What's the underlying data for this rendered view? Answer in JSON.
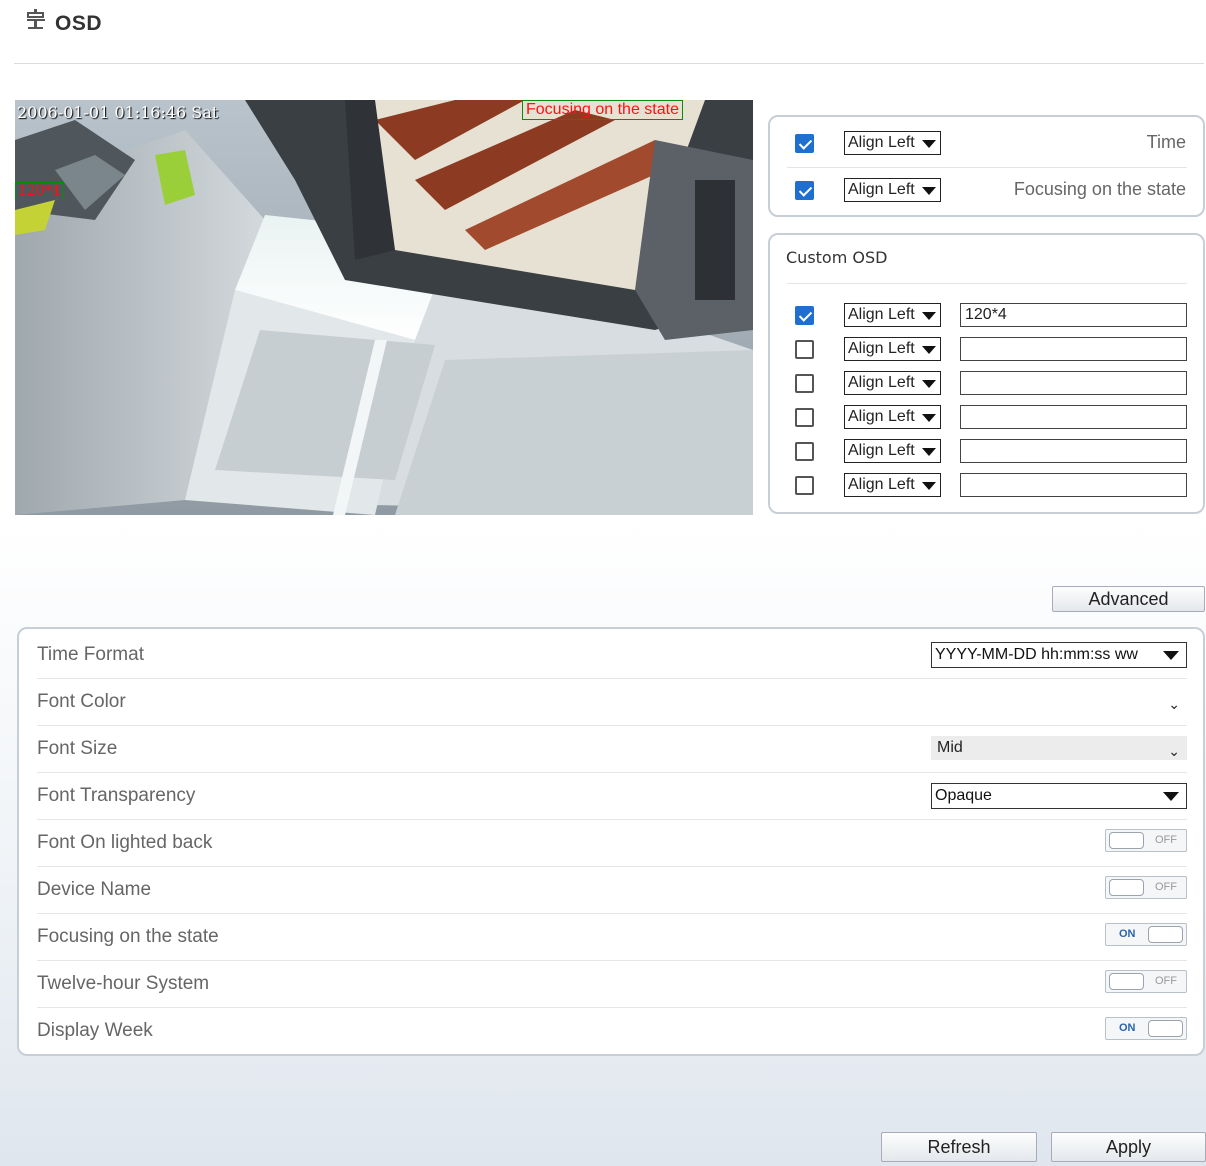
{
  "header": {
    "title": "OSD",
    "icon": "osd-settings-icon"
  },
  "preview": {
    "osd_time": "2006-01-01 01:16:46 Sat",
    "osd_focus": "Focusing on the state",
    "osd_custom": "120*4"
  },
  "basic_osd": {
    "rows": [
      {
        "checked": true,
        "align": "Align Left",
        "label": "Time"
      },
      {
        "checked": true,
        "align": "Align Left",
        "label": "Focusing on the state"
      }
    ]
  },
  "custom_osd": {
    "title": "Custom OSD",
    "rows": [
      {
        "checked": true,
        "align": "Align Left",
        "text": "120*4"
      },
      {
        "checked": false,
        "align": "Align Left",
        "text": ""
      },
      {
        "checked": false,
        "align": "Align Left",
        "text": ""
      },
      {
        "checked": false,
        "align": "Align Left",
        "text": ""
      },
      {
        "checked": false,
        "align": "Align Left",
        "text": ""
      },
      {
        "checked": false,
        "align": "Align Left",
        "text": ""
      }
    ]
  },
  "advanced_button": "Advanced",
  "settings": {
    "time_format": {
      "label": "Time Format",
      "value": "YYYY-MM-DD hh:mm:ss ww"
    },
    "font_color": {
      "label": "Font Color",
      "value": ""
    },
    "font_size": {
      "label": "Font Size",
      "value": "Mid"
    },
    "font_transparency": {
      "label": "Font Transparency",
      "value": "Opaque"
    },
    "font_on_lighted_back": {
      "label": "Font On lighted back",
      "state": "OFF"
    },
    "device_name": {
      "label": "Device Name",
      "state": "OFF"
    },
    "focusing_state": {
      "label": "Focusing on the state",
      "state": "ON"
    },
    "twelve_hour": {
      "label": "Twelve-hour System",
      "state": "OFF"
    },
    "display_week": {
      "label": "Display Week",
      "state": "ON"
    }
  },
  "buttons": {
    "refresh": "Refresh",
    "apply": "Apply"
  },
  "colors": {
    "checkbox_blue": "#1f6fd0",
    "osd_red": "#ff1111",
    "osd_green_box": "#0a8c0a",
    "toggle_on_text": "#2a64b0"
  }
}
